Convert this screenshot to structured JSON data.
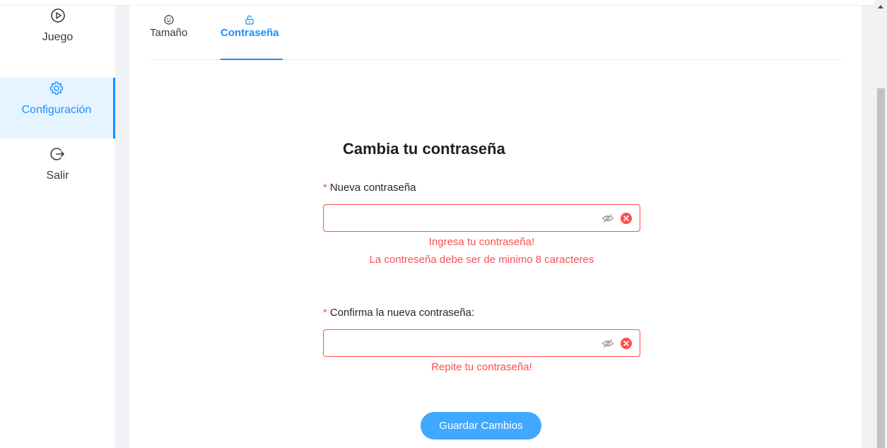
{
  "sidebar": {
    "items": [
      {
        "label": "Juego",
        "icon": "play-circle-icon"
      },
      {
        "label": "Configuración",
        "icon": "gear-icon",
        "active": true
      },
      {
        "label": "Salir",
        "icon": "logout-icon"
      }
    ]
  },
  "tabs": [
    {
      "label": "Tamaño",
      "icon": "smile-icon"
    },
    {
      "label": "Contraseña",
      "icon": "unlock-icon",
      "active": true
    }
  ],
  "form": {
    "title": "Cambia tu contraseña",
    "new_password": {
      "required_mark": "*",
      "label": "Nueva contraseña",
      "value": "",
      "errors": [
        "Ingresa tu contraseña!",
        "La contreseña debe ser de minimo 8 caracteres"
      ]
    },
    "confirm_password": {
      "required_mark": "*",
      "label": "Confirma la nueva contraseña:",
      "value": "",
      "errors": [
        "Repite tu contraseña!"
      ]
    },
    "save_label": "Guardar Cambios"
  },
  "colors": {
    "accent": "#1890ff",
    "error": "#ff4d4f",
    "button": "#40a9ff",
    "active_bg": "#e6f4ff"
  }
}
